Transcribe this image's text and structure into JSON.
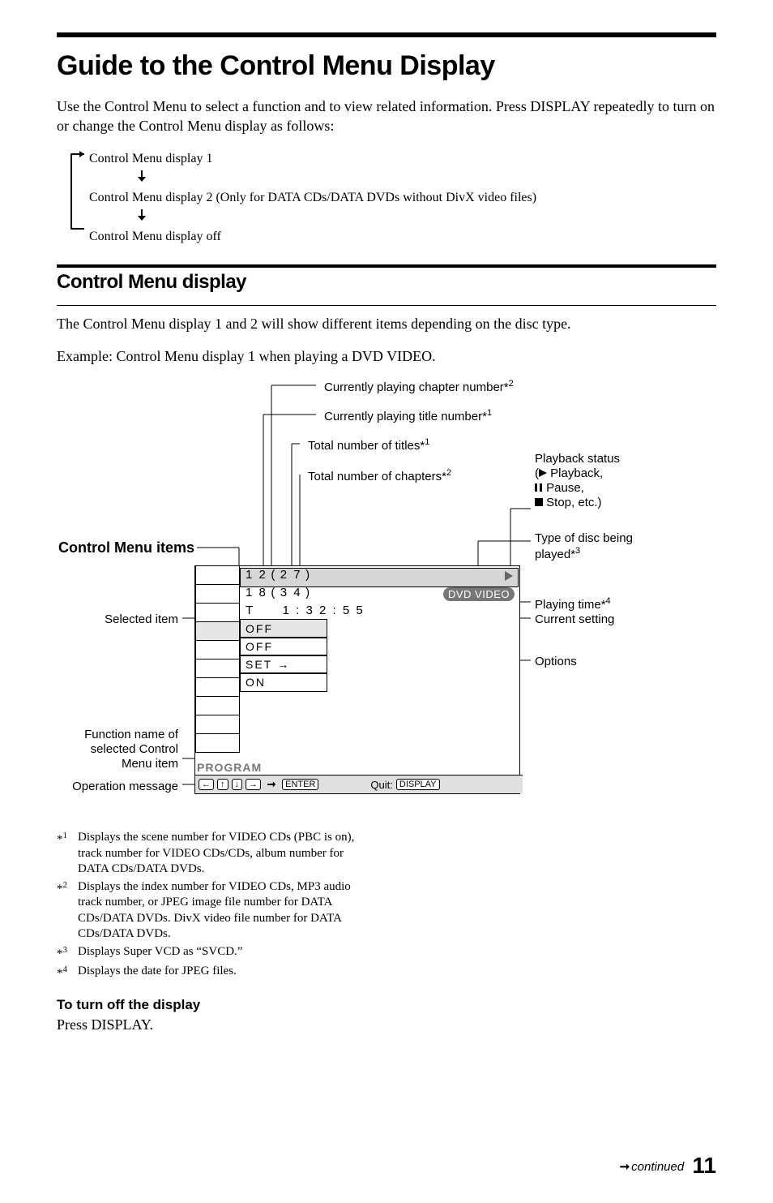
{
  "title": "Guide to the Control Menu Display",
  "intro": "Use the Control Menu to select a function and to view related information. Press DISPLAY repeatedly to turn on or change the Control Menu display as follows:",
  "sequence": {
    "item1": "Control Menu display 1",
    "item2": "Control Menu display 2 (Only for DATA CDs/DATA DVDs without DivX video files)",
    "item3": "Control Menu display off"
  },
  "section_heading": "Control Menu display",
  "section_lead": "The Control Menu display 1 and 2 will show different items depending on the disc type.",
  "example_line": "Example: Control Menu display 1 when playing a DVD VIDEO.",
  "items_heading": "Control Menu items",
  "callouts": {
    "chapter_num": "Currently playing chapter number",
    "title_num": "Currently playing title number",
    "total_titles": "Total number of titles",
    "total_chapters": "Total number of chapters",
    "playback_status": "Playback status",
    "playback_status_sub1": "Playback,",
    "playback_status_sub2": "Pause,",
    "playback_status_sub3": "Stop, etc.)",
    "disc_type": "Type of disc being played",
    "playing_time": "Playing time",
    "current_setting": "Current setting",
    "options": "Options",
    "selected_item": "Selected item",
    "func_name1": "Function name of",
    "func_name2": "selected Control",
    "func_name3": "Menu item",
    "op_message": "Operation message"
  },
  "panel": {
    "title_cur": "1 2",
    "title_total": "2 7",
    "chapter_cur": "1 8",
    "chapter_total": "3 4",
    "time_label": "T",
    "time_value": "1 : 3 2 : 5 5",
    "options": [
      "OFF",
      "OFF",
      "SET",
      "ON"
    ],
    "disc_badge": "DVD VIDEO",
    "program_label": "PROGRAM",
    "enter_key": "ENTER",
    "quit_label": "Quit:",
    "display_key": "DISPLAY"
  },
  "footnotes": {
    "f1": "Displays the scene number for VIDEO CDs (PBC is on), track number for VIDEO CDs/CDs, album number for DATA CDs/DATA DVDs.",
    "f2": "Displays the index number for VIDEO CDs, MP3 audio track number, or JPEG image file number for DATA CDs/DATA DVDs. DivX video file number for DATA CDs/DATA DVDs.",
    "f3": "Displays Super VCD as “SVCD.”",
    "f4": "Displays the date for JPEG files."
  },
  "turn_off_heading": "To turn off the display",
  "turn_off_body": "Press DISPLAY.",
  "continued": "continued",
  "page_number": "11"
}
